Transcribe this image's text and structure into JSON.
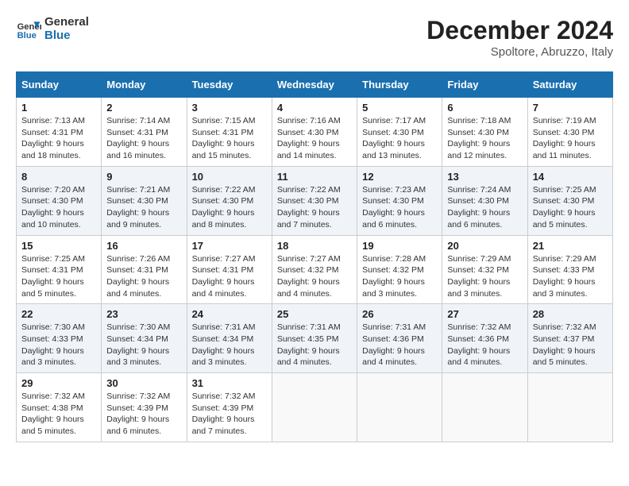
{
  "header": {
    "logo_general": "General",
    "logo_blue": "Blue",
    "month_year": "December 2024",
    "location": "Spoltore, Abruzzo, Italy"
  },
  "weekdays": [
    "Sunday",
    "Monday",
    "Tuesday",
    "Wednesday",
    "Thursday",
    "Friday",
    "Saturday"
  ],
  "weeks": [
    [
      {
        "day": "1",
        "sunrise": "7:13 AM",
        "sunset": "4:31 PM",
        "daylight": "9 hours and 18 minutes."
      },
      {
        "day": "2",
        "sunrise": "7:14 AM",
        "sunset": "4:31 PM",
        "daylight": "9 hours and 16 minutes."
      },
      {
        "day": "3",
        "sunrise": "7:15 AM",
        "sunset": "4:31 PM",
        "daylight": "9 hours and 15 minutes."
      },
      {
        "day": "4",
        "sunrise": "7:16 AM",
        "sunset": "4:30 PM",
        "daylight": "9 hours and 14 minutes."
      },
      {
        "day": "5",
        "sunrise": "7:17 AM",
        "sunset": "4:30 PM",
        "daylight": "9 hours and 13 minutes."
      },
      {
        "day": "6",
        "sunrise": "7:18 AM",
        "sunset": "4:30 PM",
        "daylight": "9 hours and 12 minutes."
      },
      {
        "day": "7",
        "sunrise": "7:19 AM",
        "sunset": "4:30 PM",
        "daylight": "9 hours and 11 minutes."
      }
    ],
    [
      {
        "day": "8",
        "sunrise": "7:20 AM",
        "sunset": "4:30 PM",
        "daylight": "9 hours and 10 minutes."
      },
      {
        "day": "9",
        "sunrise": "7:21 AM",
        "sunset": "4:30 PM",
        "daylight": "9 hours and 9 minutes."
      },
      {
        "day": "10",
        "sunrise": "7:22 AM",
        "sunset": "4:30 PM",
        "daylight": "9 hours and 8 minutes."
      },
      {
        "day": "11",
        "sunrise": "7:22 AM",
        "sunset": "4:30 PM",
        "daylight": "9 hours and 7 minutes."
      },
      {
        "day": "12",
        "sunrise": "7:23 AM",
        "sunset": "4:30 PM",
        "daylight": "9 hours and 6 minutes."
      },
      {
        "day": "13",
        "sunrise": "7:24 AM",
        "sunset": "4:30 PM",
        "daylight": "9 hours and 6 minutes."
      },
      {
        "day": "14",
        "sunrise": "7:25 AM",
        "sunset": "4:30 PM",
        "daylight": "9 hours and 5 minutes."
      }
    ],
    [
      {
        "day": "15",
        "sunrise": "7:25 AM",
        "sunset": "4:31 PM",
        "daylight": "9 hours and 5 minutes."
      },
      {
        "day": "16",
        "sunrise": "7:26 AM",
        "sunset": "4:31 PM",
        "daylight": "9 hours and 4 minutes."
      },
      {
        "day": "17",
        "sunrise": "7:27 AM",
        "sunset": "4:31 PM",
        "daylight": "9 hours and 4 minutes."
      },
      {
        "day": "18",
        "sunrise": "7:27 AM",
        "sunset": "4:32 PM",
        "daylight": "9 hours and 4 minutes."
      },
      {
        "day": "19",
        "sunrise": "7:28 AM",
        "sunset": "4:32 PM",
        "daylight": "9 hours and 3 minutes."
      },
      {
        "day": "20",
        "sunrise": "7:29 AM",
        "sunset": "4:32 PM",
        "daylight": "9 hours and 3 minutes."
      },
      {
        "day": "21",
        "sunrise": "7:29 AM",
        "sunset": "4:33 PM",
        "daylight": "9 hours and 3 minutes."
      }
    ],
    [
      {
        "day": "22",
        "sunrise": "7:30 AM",
        "sunset": "4:33 PM",
        "daylight": "9 hours and 3 minutes."
      },
      {
        "day": "23",
        "sunrise": "7:30 AM",
        "sunset": "4:34 PM",
        "daylight": "9 hours and 3 minutes."
      },
      {
        "day": "24",
        "sunrise": "7:31 AM",
        "sunset": "4:34 PM",
        "daylight": "9 hours and 3 minutes."
      },
      {
        "day": "25",
        "sunrise": "7:31 AM",
        "sunset": "4:35 PM",
        "daylight": "9 hours and 4 minutes."
      },
      {
        "day": "26",
        "sunrise": "7:31 AM",
        "sunset": "4:36 PM",
        "daylight": "9 hours and 4 minutes."
      },
      {
        "day": "27",
        "sunrise": "7:32 AM",
        "sunset": "4:36 PM",
        "daylight": "9 hours and 4 minutes."
      },
      {
        "day": "28",
        "sunrise": "7:32 AM",
        "sunset": "4:37 PM",
        "daylight": "9 hours and 5 minutes."
      }
    ],
    [
      {
        "day": "29",
        "sunrise": "7:32 AM",
        "sunset": "4:38 PM",
        "daylight": "9 hours and 5 minutes."
      },
      {
        "day": "30",
        "sunrise": "7:32 AM",
        "sunset": "4:39 PM",
        "daylight": "9 hours and 6 minutes."
      },
      {
        "day": "31",
        "sunrise": "7:32 AM",
        "sunset": "4:39 PM",
        "daylight": "9 hours and 7 minutes."
      },
      null,
      null,
      null,
      null
    ]
  ]
}
